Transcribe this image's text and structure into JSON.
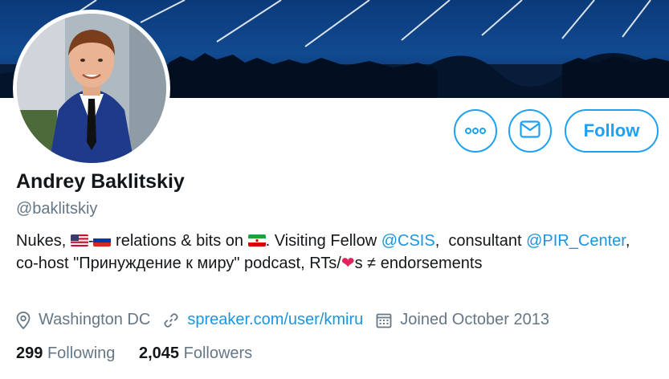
{
  "profile": {
    "name": "Andrey Baklitskiy",
    "handle": "@baklitskiy",
    "follow_label": "Follow"
  },
  "bio": {
    "part1": "Nukes, ",
    "part2": "-",
    "part3": " relations & bits on ",
    "part4": ". Visiting Fellow ",
    "mention1": "@CSIS",
    "part5": ",  consultant ",
    "mention2": "@PIR_Center",
    "part6": ", co-host \"Принуждение к миру\" podcast, RTs/",
    "part7": "s ≠ endorsements"
  },
  "meta": {
    "location": "Washington DC",
    "website": "spreaker.com/user/kmiru",
    "joined": "Joined October 2013"
  },
  "stats": {
    "following_count": "299",
    "following_label": "Following",
    "followers_count": "2,045",
    "followers_label": "Followers"
  },
  "icons": {
    "more": "more-dots-icon",
    "message": "envelope-icon",
    "location": "location-pin-icon",
    "website": "link-icon",
    "joined": "calendar-icon",
    "heart": "heart-icon"
  },
  "colors": {
    "accent": "#1da1f2",
    "link": "#1b95e0",
    "secondary_text": "#657786",
    "heart": "#e0245e"
  }
}
